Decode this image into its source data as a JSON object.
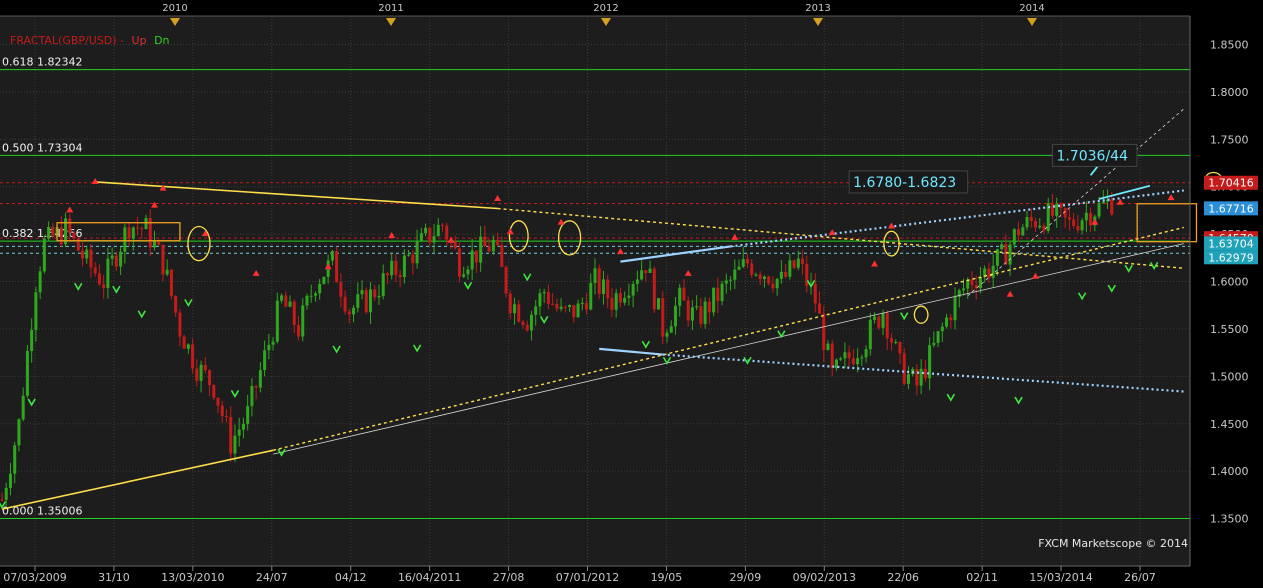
{
  "title_parts": {
    "name": "FRACTAL(GBP/USD) -",
    "up": "Up",
    "dn": "Dn"
  },
  "watermark": "FXCM Marketscope © 2014",
  "colors": {
    "background": "#000000",
    "plot_bg": "#1d1d1d",
    "grid": "#3c3c3c",
    "bull": "#2fa81f",
    "bear": "#c61b1b",
    "axis_text": "#c8c8c8"
  },
  "chart_data": {
    "type": "candlestick",
    "instrument": "GBP/USD",
    "years": [
      "2010",
      "2011",
      "2012",
      "2013",
      "2014"
    ],
    "x_tick_labels": [
      "07/03/2009",
      "31/10",
      "13/03/2010",
      "24/07",
      "04/12",
      "16/04/2011",
      "27/08",
      "07/01/2012",
      "19/05",
      "29/09",
      "09/02/2013",
      "22/06",
      "02/11",
      "15/03/2014",
      "26/07"
    ],
    "y_ticks": [
      1.35,
      1.4,
      1.45,
      1.5,
      1.55,
      1.6,
      1.65,
      1.7,
      1.75,
      1.8,
      1.85
    ],
    "y_tick_labels": [
      "1.3500",
      "1.4000",
      "1.4500",
      "1.5000",
      "1.5500",
      "1.6000",
      "1.6500",
      "1.7000",
      "1.7500",
      "1.8000",
      "1.8500"
    ],
    "ylim": [
      1.3,
      1.88
    ],
    "x_range_weeks": [
      0,
      280
    ],
    "fib_levels": [
      {
        "ratio": "0.618",
        "value": 1.82342,
        "label": "0.618 1.82342"
      },
      {
        "ratio": "0.500",
        "value": 1.73304,
        "label": "0.500 1.73304"
      },
      {
        "ratio": "0.382",
        "value": 1.64266,
        "label": "0.382 1.64266"
      },
      {
        "ratio": "0.000",
        "value": 1.35006,
        "label": "0.000 1.35006"
      }
    ],
    "price_tags": [
      {
        "label": "1.70416",
        "value": 1.70416,
        "color": "#c61b1b"
      },
      {
        "label": "1.67716",
        "value": 1.67716,
        "color": "#2a8fd6"
      },
      {
        "label": "1.64570",
        "value": 1.6457,
        "color": "#c61b1b"
      },
      {
        "label": "1.63704",
        "value": 1.63704,
        "color": "#1fa2b8"
      },
      {
        "label": "1.62979",
        "value": 1.62979,
        "color": "#1fa2b8"
      }
    ],
    "horizontal_dashed": [
      {
        "value": 1.7041,
        "color": "#c61b1b"
      },
      {
        "value": 1.6823,
        "color": "#c61b1b"
      },
      {
        "value": 1.6457,
        "color": "#c61b1b"
      },
      {
        "value": 1.637,
        "color": "#6fd0d8"
      },
      {
        "value": 1.6298,
        "color": "#6fd0d8"
      }
    ],
    "annotations": [
      {
        "text": "1.7036/44",
        "x": 248,
        "y": 1.733
      },
      {
        "text": "1.6780-1.6823",
        "x": 200,
        "y": 1.705
      }
    ],
    "anchors": [
      [
        0,
        1.37
      ],
      [
        4,
        1.45
      ],
      [
        8,
        1.6
      ],
      [
        10,
        1.64
      ],
      [
        15,
        1.655
      ],
      [
        20,
        1.62
      ],
      [
        24,
        1.6
      ],
      [
        30,
        1.66
      ],
      [
        34,
        1.655
      ],
      [
        38,
        1.62
      ],
      [
        42,
        1.55
      ],
      [
        46,
        1.51
      ],
      [
        50,
        1.49
      ],
      [
        54,
        1.43
      ],
      [
        58,
        1.46
      ],
      [
        62,
        1.52
      ],
      [
        66,
        1.58
      ],
      [
        70,
        1.55
      ],
      [
        74,
        1.6
      ],
      [
        78,
        1.62
      ],
      [
        82,
        1.57
      ],
      [
        86,
        1.58
      ],
      [
        90,
        1.6
      ],
      [
        95,
        1.62
      ],
      [
        100,
        1.645
      ],
      [
        104,
        1.66
      ],
      [
        108,
        1.62
      ],
      [
        112,
        1.63
      ],
      [
        116,
        1.64
      ],
      [
        120,
        1.58
      ],
      [
        124,
        1.56
      ],
      [
        128,
        1.59
      ],
      [
        132,
        1.565
      ],
      [
        136,
        1.57
      ],
      [
        140,
        1.6
      ],
      [
        144,
        1.58
      ],
      [
        148,
        1.6
      ],
      [
        152,
        1.62
      ],
      [
        156,
        1.55
      ],
      [
        160,
        1.58
      ],
      [
        164,
        1.56
      ],
      [
        168,
        1.58
      ],
      [
        172,
        1.6
      ],
      [
        176,
        1.62
      ],
      [
        180,
        1.61
      ],
      [
        184,
        1.6
      ],
      [
        188,
        1.62
      ],
      [
        192,
        1.58
      ],
      [
        196,
        1.5
      ],
      [
        200,
        1.52
      ],
      [
        204,
        1.54
      ],
      [
        208,
        1.57
      ],
      [
        212,
        1.51
      ],
      [
        216,
        1.49
      ],
      [
        220,
        1.53
      ],
      [
        224,
        1.57
      ],
      [
        228,
        1.6
      ],
      [
        232,
        1.61
      ],
      [
        236,
        1.625
      ],
      [
        240,
        1.655
      ],
      [
        244,
        1.665
      ],
      [
        248,
        1.67
      ],
      [
        252,
        1.66
      ],
      [
        256,
        1.672
      ],
      [
        260,
        1.68
      ],
      [
        262,
        1.685
      ]
    ],
    "trendlines": [
      {
        "x1": 22,
        "y1": 1.705,
        "x2": 117,
        "y2": 1.677,
        "color": "#ffe04a",
        "width": 1.6,
        "dash": ""
      },
      {
        "x1": 117,
        "y1": 1.677,
        "x2": 279,
        "y2": 1.614,
        "color": "#ffe04a",
        "width": 1.4,
        "dash": "3,3"
      },
      {
        "x1": 0,
        "y1": 1.36,
        "x2": 64,
        "y2": 1.422,
        "color": "#ffe04a",
        "width": 1.6,
        "dash": ""
      },
      {
        "x1": 64,
        "y1": 1.422,
        "x2": 279,
        "y2": 1.657,
        "color": "#ffe04a",
        "width": 1.4,
        "dash": "3,3"
      },
      {
        "x1": 64,
        "y1": 1.418,
        "x2": 279,
        "y2": 1.64,
        "color": "#d8d8d8",
        "width": 0.8,
        "dash": ""
      },
      {
        "x1": 228,
        "y1": 1.585,
        "x2": 279,
        "y2": 1.782,
        "color": "#d8d8d8",
        "width": 0.8,
        "dash": "3,3"
      },
      {
        "x1": 146,
        "y1": 1.621,
        "x2": 172,
        "y2": 1.637,
        "color": "#9ed3ff",
        "width": 2.2,
        "dash": ""
      },
      {
        "x1": 172,
        "y1": 1.637,
        "x2": 279,
        "y2": 1.696,
        "color": "#9ed3ff",
        "width": 2.2,
        "dash": "2,3"
      },
      {
        "x1": 141,
        "y1": 1.529,
        "x2": 156,
        "y2": 1.523,
        "color": "#9ed3ff",
        "width": 2.2,
        "dash": ""
      },
      {
        "x1": 156,
        "y1": 1.523,
        "x2": 279,
        "y2": 1.484,
        "color": "#9ed3ff",
        "width": 2.2,
        "dash": "2,3"
      },
      {
        "x1": 260,
        "y1": 1.729,
        "x2": 257,
        "y2": 1.712,
        "color": "#6fe8ff",
        "width": 1.8,
        "dash": ""
      },
      {
        "x1": 259,
        "y1": 1.687,
        "x2": 271,
        "y2": 1.701,
        "color": "#6fe8ff",
        "width": 1.8,
        "dash": ""
      }
    ],
    "boxes": [
      {
        "x1": 13,
        "y1": 1.643,
        "x2": 42,
        "y2": 1.662,
        "color": "#f0a020"
      },
      {
        "x1": 268,
        "y1": 1.642,
        "x2": 282,
        "y2": 1.682,
        "color": "#f0a020"
      }
    ],
    "ellipses": [
      {
        "cx": 46.5,
        "cy": 1.64,
        "rx": 2.6,
        "ry": 0.018,
        "color": "#ffe04a"
      },
      {
        "cx": 122,
        "cy": 1.648,
        "rx": 2.2,
        "ry": 0.016,
        "color": "#ffe04a"
      },
      {
        "cx": 134,
        "cy": 1.646,
        "rx": 2.6,
        "ry": 0.018,
        "color": "#ffe04a"
      },
      {
        "cx": 210,
        "cy": 1.64,
        "rx": 1.8,
        "ry": 0.013,
        "color": "#ffe04a"
      },
      {
        "cx": 217,
        "cy": 1.565,
        "rx": 1.6,
        "ry": 0.009,
        "color": "#ffe04a"
      },
      {
        "cx": 286,
        "cy": 1.709,
        "rx": 1.8,
        "ry": 0.006,
        "color": "#ffe04a"
      }
    ],
    "fractal_up": [
      [
        22,
        1.705
      ],
      [
        16,
        1.675
      ],
      [
        36,
        1.68
      ],
      [
        38,
        1.698
      ],
      [
        48,
        1.65
      ],
      [
        60,
        1.608
      ],
      [
        77,
        1.615
      ],
      [
        92,
        1.648
      ],
      [
        106,
        1.643
      ],
      [
        117,
        1.687
      ],
      [
        120,
        1.652
      ],
      [
        132,
        1.662
      ],
      [
        146,
        1.631
      ],
      [
        162,
        1.608
      ],
      [
        173,
        1.646
      ],
      [
        196,
        1.651
      ],
      [
        206,
        1.618
      ],
      [
        210,
        1.658
      ],
      [
        238,
        1.586
      ],
      [
        244,
        1.605
      ],
      [
        258,
        1.662
      ],
      [
        264,
        1.683
      ],
      [
        276,
        1.688
      ]
    ],
    "fractal_dn": [
      [
        0,
        1.365
      ],
      [
        7,
        1.473
      ],
      [
        18,
        1.595
      ],
      [
        27,
        1.592
      ],
      [
        33,
        1.566
      ],
      [
        44,
        1.578
      ],
      [
        55,
        1.482
      ],
      [
        66,
        1.42
      ],
      [
        79,
        1.529
      ],
      [
        98,
        1.53
      ],
      [
        110,
        1.596
      ],
      [
        124,
        1.605
      ],
      [
        128,
        1.56
      ],
      [
        152,
        1.534
      ],
      [
        157,
        1.517
      ],
      [
        176,
        1.517
      ],
      [
        184,
        1.545
      ],
      [
        191,
        1.598
      ],
      [
        213,
        1.564
      ],
      [
        224,
        1.478
      ],
      [
        240,
        1.475
      ],
      [
        255,
        1.585
      ],
      [
        262,
        1.593
      ],
      [
        266,
        1.614
      ],
      [
        272,
        1.617
      ]
    ]
  }
}
